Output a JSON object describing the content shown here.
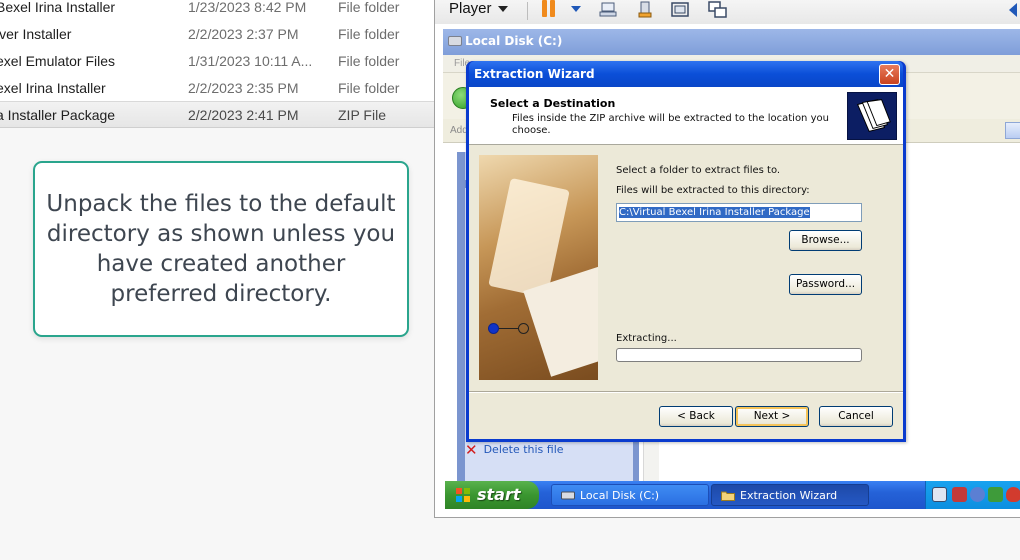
{
  "host_files": [
    {
      "name": "Bexel Irina Installer",
      "date": "1/23/2023 8:42 PM",
      "type": "File folder",
      "selected": false
    },
    {
      "name": "iver Installer",
      "date": "2/2/2023 2:37 PM",
      "type": "File folder",
      "selected": false
    },
    {
      "name": "exel Emulator Files",
      "date": "1/31/2023 10:11 A...",
      "type": "File folder",
      "selected": false
    },
    {
      "name": "exel Irina Installer",
      "date": "2/2/2023 2:35 PM",
      "type": "File folder",
      "selected": false
    },
    {
      "name": "a Installer Package",
      "date": "2/2/2023 2:41 PM",
      "type": "ZIP File",
      "selected": true
    }
  ],
  "callout": {
    "text": "Unpack the files to the default directory as shown unless you have created another preferred directory.",
    "border_color": "#2aa58d"
  },
  "vm_toolbar": {
    "player_label": "Player",
    "icons": [
      "pause-icon",
      "send-ctrl-alt-del-icon",
      "removable-devices-icon",
      "fit-window-icon",
      "unity-mode-icon"
    ]
  },
  "xp_explorer": {
    "title": "Local Disk (C:)",
    "menu_text": "File",
    "address_label": "Add",
    "delete_label": "Delete this file"
  },
  "wizard": {
    "title": "Extraction Wizard",
    "header_title": "Select a Destination",
    "header_subtitle": "Files inside the ZIP archive will be extracted to the location you choose.",
    "prompt": "Select a folder to extract files to.",
    "dir_label": "Files will be extracted to this directory:",
    "dir_value": "C:\\Virtual Bexel Irina Installer Package",
    "browse_label": "Browse...",
    "password_label": "Password...",
    "extracting_label": "Extracting...",
    "progress": 0,
    "back_label": "< Back",
    "next_label": "Next >",
    "cancel_label": "Cancel",
    "close_glyph": "✕"
  },
  "taskbar": {
    "start_label": "start",
    "tasks": [
      {
        "label": "Local Disk (C:)",
        "active": false
      },
      {
        "label": "Extraction Wizard",
        "active": true
      }
    ]
  },
  "colors": {
    "xp_title_blue": "#0a3bce",
    "progress_green": "#2bc42b",
    "start_green": "#3a9630"
  }
}
